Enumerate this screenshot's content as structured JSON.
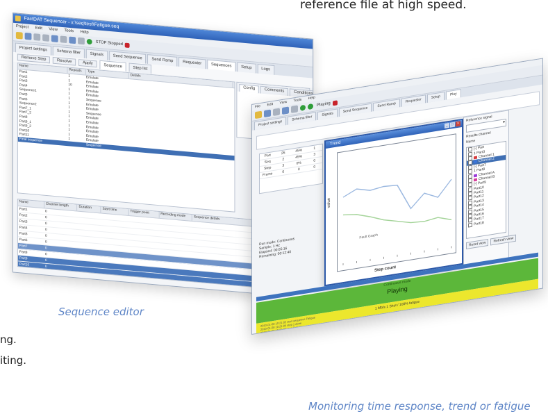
{
  "header_text": "reference file at high speed.",
  "captions": {
    "sequence_editor": "Sequence editor",
    "monitoring": "Monitoring time response, trend or fatigue"
  },
  "side_text": [
    "ng.",
    "iting."
  ],
  "seq_window": {
    "title": "FactDAT Sequencer - x:\\seq\\test\\Fatigue.seq",
    "menu": [
      "Project",
      "Edit",
      "View",
      "Tools",
      "Help"
    ],
    "toolbar_status": "STOP  Stopped",
    "tabs": [
      "Project settings",
      "Schema filter",
      "Signals",
      "Send Sequence",
      "Send Ramp",
      "Requester",
      "Sequences",
      "Setup",
      "Logs"
    ],
    "buttons": [
      "Remove Step",
      "Resolve",
      "Apply"
    ],
    "sub_tabs": [
      "Sequence",
      "Step list"
    ],
    "columns": [
      "Name",
      "Repeats",
      "Type",
      "Details"
    ],
    "steps": [
      {
        "name": "Part1",
        "repeats": "1",
        "type": "Emulate",
        "details": ""
      },
      {
        "name": "Part2",
        "repeats": "1",
        "type": "Emulate",
        "details": ""
      },
      {
        "name": "Part3",
        "repeats": "10",
        "type": "Emulate",
        "details": ""
      },
      {
        "name": "Part4",
        "repeats": "1",
        "type": "Emulate",
        "details": ""
      },
      {
        "name": "Sequence1",
        "repeats": "1",
        "type": "Emulate",
        "details": ""
      },
      {
        "name": "Part5",
        "repeats": "1",
        "type": "Sequence",
        "details": ""
      },
      {
        "name": "Part6",
        "repeats": "1",
        "type": "Emulate",
        "details": ""
      },
      {
        "name": "Sequence2",
        "repeats": "1",
        "type": "Emulate",
        "details": ""
      },
      {
        "name": "Part7_1",
        "repeats": "1",
        "type": "Sequence",
        "details": ""
      },
      {
        "name": "Part7_2",
        "repeats": "1",
        "type": "Emulate",
        "details": ""
      },
      {
        "name": "Part8",
        "repeats": "1",
        "type": "Emulate",
        "details": ""
      },
      {
        "name": "Part9_1",
        "repeats": "1",
        "type": "Emulate",
        "details": ""
      },
      {
        "name": "Part9_2",
        "repeats": "1",
        "type": "Emulate",
        "details": ""
      },
      {
        "name": "Part10",
        "repeats": "1",
        "type": "Emulate",
        "details": ""
      },
      {
        "name": "Part11",
        "repeats": "1",
        "type": "Emulate",
        "details": ""
      },
      {
        "name": "Final sequence",
        "repeats": "",
        "type": "Sequence",
        "details": ""
      }
    ],
    "side_tabs": [
      "Config",
      "Comments",
      "Conditions"
    ],
    "log_columns": [
      "Name",
      "Channel length",
      "Duration",
      "Start time",
      "Trigger point",
      "Recording mode",
      "Sequence details"
    ],
    "log_rows": [
      {
        "name": "Part1",
        "len": "0",
        "dur": "",
        "start": "",
        "trig": "",
        "mode": "",
        "det": ""
      },
      {
        "name": "Part2",
        "len": "0",
        "dur": "",
        "start": "",
        "trig": "",
        "mode": "",
        "det": ""
      },
      {
        "name": "Part3",
        "len": "0",
        "dur": "",
        "start": "",
        "trig": "",
        "mode": "",
        "det": ""
      },
      {
        "name": "Part4",
        "len": "0",
        "dur": "",
        "start": "",
        "trig": "",
        "mode": "",
        "det": ""
      },
      {
        "name": "Part5",
        "len": "0",
        "dur": "",
        "start": "",
        "trig": "",
        "mode": "",
        "det": ""
      },
      {
        "name": "Part6",
        "len": "0",
        "dur": "",
        "start": "",
        "trig": "",
        "mode": "",
        "det": ""
      },
      {
        "name": "Part7",
        "len": "0",
        "dur": "",
        "start": "",
        "trig": "",
        "mode": "",
        "det": ""
      },
      {
        "name": "Part8",
        "len": "0",
        "dur": "",
        "start": "",
        "trig": "",
        "mode": "",
        "det": ""
      },
      {
        "name": "Part9",
        "len": "0",
        "dur": "",
        "start": "",
        "trig": "",
        "mode": "",
        "det": ""
      },
      {
        "name": "Part10",
        "len": "0",
        "dur": "",
        "start": "",
        "trig": "",
        "mode": "",
        "det": ""
      },
      {
        "name": "Part11",
        "len": "0",
        "dur": "",
        "start": "",
        "trig": "",
        "mode": "",
        "det": ""
      }
    ]
  },
  "monitor_window": {
    "menu": [
      "File",
      "Edit",
      "View",
      "Tools",
      "Help"
    ],
    "toolbar_status": "Playing",
    "tabs": [
      "Project settings",
      "Schema filter",
      "Signals",
      "Send Sequence",
      "Send Ramp",
      "Requester",
      "Setup",
      "Play"
    ],
    "mini_table": {
      "rows": [
        [
          "Part",
          "25",
          "45%",
          "1"
        ],
        [
          "Seq",
          "2",
          "45%",
          "3"
        ],
        [
          "Step",
          "3",
          "0%",
          "0"
        ],
        [
          "Frame",
          "0",
          "0",
          "0"
        ]
      ]
    },
    "dialog": {
      "title": "Trend",
      "xlabel": "Step count",
      "ylabel": "value",
      "annotation": "Fault Graph"
    },
    "legend_pane": {
      "label_top": "Reference signal",
      "combo_value": "",
      "label_list": "Results channel",
      "label_name": "Name",
      "items": [
        "[-] Part",
        "1 Part3",
        "Channel 1",
        "Channel 2",
        "[-] Part7",
        "1 Part8",
        "Channel A",
        "Channel B",
        "[-] Part9",
        "Part10",
        "Part11",
        "Part12",
        "Part13",
        "Part14",
        "Part15",
        "Part16",
        "Part17",
        "Part18"
      ],
      "buttons": [
        "Reset view",
        "Refresh view"
      ]
    },
    "info_lines": [
      "Run mode:   Continuous",
      "Sample:     1 Hz",
      "Elapsed:    00:05:16",
      "Remaining:  00:12:40"
    ],
    "status": {
      "mode_label": "Continuous mode",
      "state": "Playing",
      "info": "1 Mb/s  1 Shot / 100% fatigue"
    },
    "log_lines": [
      "2010-01-08 10:21:02  start sequence Fatigue",
      "2010-01-08 10:21:04  step 1 done",
      "2010-01-08 10:21:06  step 2 done"
    ]
  },
  "chart_data": {
    "type": "line",
    "title": "",
    "xlabel": "Step count",
    "ylabel": "value",
    "x": [
      0,
      1,
      2,
      3,
      4,
      5,
      6,
      7,
      8
    ],
    "series": [
      {
        "values": [
          0.55,
          0.62,
          0.58,
          0.6,
          0.59,
          0.3,
          0.45,
          0.38,
          0.56
        ]
      },
      {
        "values": [
          0.35,
          0.33,
          0.28,
          0.22,
          0.18,
          0.14,
          0.13,
          0.15,
          0.1
        ]
      }
    ],
    "ylim": [
      -0.2,
      1.0
    ],
    "grid": false,
    "colors": [
      "#9bb8e0",
      "#a5d49a"
    ]
  }
}
